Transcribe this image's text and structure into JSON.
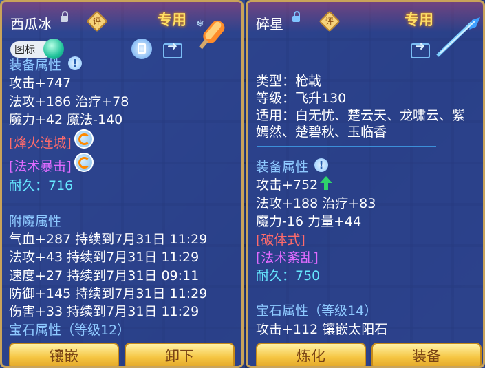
{
  "left": {
    "name": "西瓜冰",
    "rate_badge": "评",
    "exclusive": "专用",
    "icon_toggle_label": "图标",
    "equip_attr_title": "装备属性",
    "lines": [
      "攻击+747",
      "法攻+186 治疗+78",
      "魔力+42 魔法-140"
    ],
    "skill1": "[烽火连城]",
    "skill2": "[法术暴击]",
    "durability": "耐久：716",
    "enchant_title": "附魔属性",
    "enchant": [
      "气血+287 持续到7月31日 11:29",
      "法攻+43 持续到7月31日 11:29",
      "速度+27 持续到7月31日 09:11",
      "防御+145 持续到7月31日 11:29",
      "伤害+33 持续到7月31日 11:29"
    ],
    "gem_title": "宝石属性（等级12）",
    "btn1": "镶嵌",
    "btn2": "卸下"
  },
  "right": {
    "name": "碎星",
    "rate_badge": "评",
    "exclusive": "专用",
    "type": "类型：枪戟",
    "level": "等级：飞升130",
    "suit_line1": "适用：白无忧、楚云天、龙啸云、紫",
    "suit_line2": "嫣然、楚碧秋、玉临香",
    "equip_attr_title": "装备属性",
    "attack": "攻击+752",
    "lines": [
      "法攻+188 治疗+83",
      "魔力-16 力量+44"
    ],
    "skill1": "[破体式]",
    "skill2": "[法术紊乱]",
    "durability": "耐久：750",
    "gem_title": "宝石属性（等级14）",
    "gem_line": "攻击+112 镶嵌太阳石",
    "btn1": "炼化",
    "btn2": "装备"
  },
  "colors": {
    "accent_gold": "#ffe066",
    "section_blue": "#8ec9ff",
    "skill_red": "#ff6b6b",
    "skill_purple": "#e06bff",
    "durability_cyan": "#66e8ff",
    "arrow_up_green": "#2fd36b"
  },
  "icons": {
    "left_lock": "unlocked-padlock-icon",
    "right_lock": "locked-padlock-icon",
    "left_item": "ice-pop-weapon-icon",
    "right_item": "spear-weapon-icon",
    "share": "share-arrow-icon",
    "info": "info-icon",
    "skill": "skill-ring-icon",
    "up": "green-up-arrow-icon"
  }
}
